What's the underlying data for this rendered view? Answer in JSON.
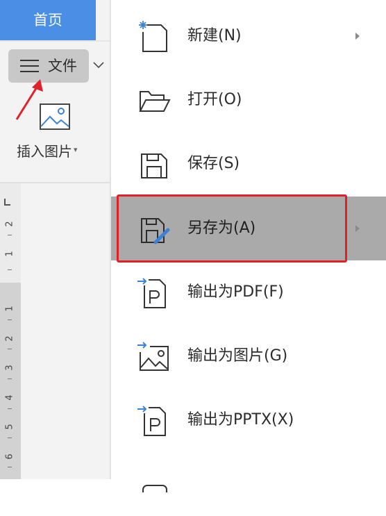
{
  "toolbar": {
    "home_tab": "首页",
    "file_button": "文件",
    "insert_image": "插入图片",
    "insert_image_caret": "▾"
  },
  "ruler": {
    "numbers_top": [
      "2",
      "1"
    ],
    "numbers_bottom": [
      "1",
      "2",
      "3",
      "4",
      "5",
      "6"
    ]
  },
  "menu": {
    "items": [
      {
        "label": "新建(N)",
        "icon": "new-document-icon",
        "has_submenu": true
      },
      {
        "label": "打开(O)",
        "icon": "folder-open-icon",
        "has_submenu": false
      },
      {
        "label": "保存(S)",
        "icon": "save-icon",
        "has_submenu": false
      },
      {
        "label": "另存为(A)",
        "icon": "save-as-icon",
        "has_submenu": true,
        "highlighted": true
      },
      {
        "label": "输出为PDF(F)",
        "icon": "export-pdf-icon",
        "has_submenu": false
      },
      {
        "label": "输出为图片(G)",
        "icon": "export-image-icon",
        "has_submenu": false
      },
      {
        "label": "输出为PPTX(X)",
        "icon": "export-pptx-icon",
        "has_submenu": false
      }
    ]
  },
  "colors": {
    "home_tab_bg": "#4a8ee6",
    "highlight_bg": "#aaaaaa",
    "annotation_red": "#e0202a",
    "icon_accent_blue": "#3b82d6"
  }
}
